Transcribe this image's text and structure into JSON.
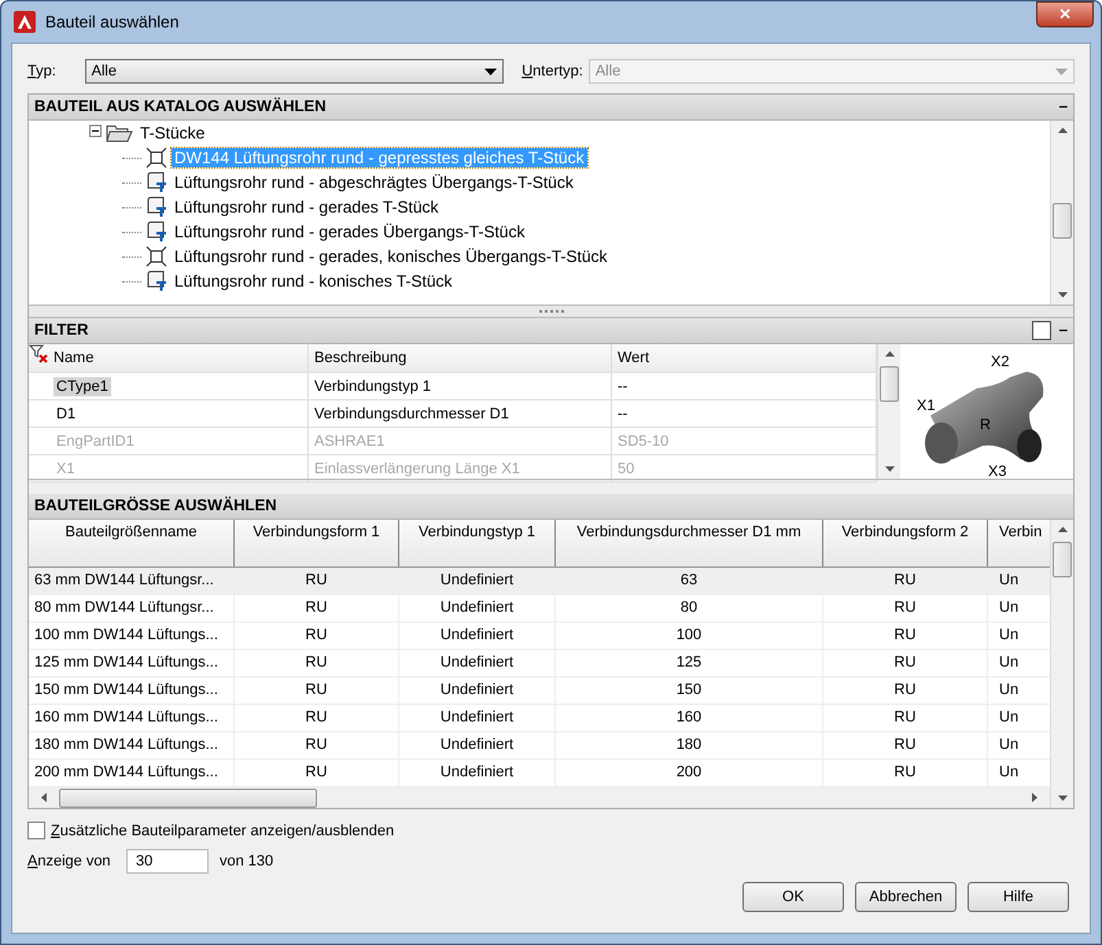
{
  "window": {
    "title": "Bauteil auswählen",
    "close": "✕"
  },
  "typ": {
    "label": "Typ:",
    "value": "Alle"
  },
  "untertyp": {
    "label": "Untertyp:",
    "value": "Alle",
    "disabled": true
  },
  "catalog": {
    "title": "BAUTEIL AUS KATALOG AUSWÄHLEN",
    "collapse": "–",
    "folder": {
      "label": "T-Stücke",
      "expanded": true,
      "children": [
        {
          "label": "DW144 Lüftungsrohr rund - gepresstes gleiches T-Stück",
          "kind": "corners",
          "selected": true
        },
        {
          "label": "Lüftungsrohr rund - abgeschrägtes Übergangs-T-Stück",
          "kind": "page",
          "selected": false
        },
        {
          "label": "Lüftungsrohr rund - gerades T-Stück",
          "kind": "page",
          "selected": false
        },
        {
          "label": "Lüftungsrohr rund - gerades Übergangs-T-Stück",
          "kind": "page",
          "selected": false
        },
        {
          "label": "Lüftungsrohr rund - gerades, konisches Übergangs-T-Stück",
          "kind": "corners",
          "selected": false
        },
        {
          "label": "Lüftungsrohr rund - konisches T-Stück",
          "kind": "page",
          "selected": false
        }
      ]
    }
  },
  "filter": {
    "title": "FILTER",
    "collapse": "–",
    "columns": [
      "Name",
      "Beschreibung",
      "Wert"
    ],
    "rows": [
      {
        "name": "CType1",
        "beschreibung": "Verbindungstyp 1",
        "wert": "--",
        "enabled": true,
        "selected": true
      },
      {
        "name": "D1",
        "beschreibung": "Verbindungsdurchmesser D1",
        "wert": "--",
        "enabled": true,
        "selected": false
      },
      {
        "name": "EngPartID1",
        "beschreibung": "ASHRAE1",
        "wert": "SD5-10",
        "enabled": false,
        "selected": false
      },
      {
        "name": "X1",
        "beschreibung": "Einlassverlängerung Länge X1",
        "wert": "50",
        "enabled": false,
        "selected": false
      }
    ],
    "preview": {
      "labels": [
        "X1",
        "X2",
        "R",
        "X3"
      ]
    }
  },
  "sizes": {
    "title": "BAUTEILGRÖSSE AUSWÄHLEN",
    "columns": [
      "Bauteilgrößenname",
      "Verbindungsform 1",
      "Verbindungstyp 1",
      "Verbindungsdurchmesser D1 mm",
      "Verbindungsform 2",
      "Verbin"
    ],
    "rows": [
      {
        "cells": [
          "63 mm DW144 Lüftungsr...",
          "RU",
          "Undefiniert",
          "63",
          "RU",
          "Un"
        ],
        "selected": true
      },
      {
        "cells": [
          "80 mm DW144 Lüftungsr...",
          "RU",
          "Undefiniert",
          "80",
          "RU",
          "Un"
        ],
        "selected": false
      },
      {
        "cells": [
          "100 mm DW144 Lüftungs...",
          "RU",
          "Undefiniert",
          "100",
          "RU",
          "Un"
        ],
        "selected": false
      },
      {
        "cells": [
          "125 mm DW144 Lüftungs...",
          "RU",
          "Undefiniert",
          "125",
          "RU",
          "Un"
        ],
        "selected": false
      },
      {
        "cells": [
          "150 mm DW144 Lüftungs...",
          "RU",
          "Undefiniert",
          "150",
          "RU",
          "Un"
        ],
        "selected": false
      },
      {
        "cells": [
          "160 mm DW144 Lüftungs...",
          "RU",
          "Undefiniert",
          "160",
          "RU",
          "Un"
        ],
        "selected": false
      },
      {
        "cells": [
          "180 mm DW144 Lüftungs...",
          "RU",
          "Undefiniert",
          "180",
          "RU",
          "Un"
        ],
        "selected": false
      },
      {
        "cells": [
          "200 mm DW144 Lüftungs...",
          "RU",
          "Undefiniert",
          "200",
          "RU",
          "Un"
        ],
        "selected": false
      }
    ]
  },
  "extra": {
    "label": "Zusätzliche Bauteilparameter anzeigen/ausblenden",
    "checked": false
  },
  "anzeige": {
    "label": "Anzeige von",
    "value": "30",
    "total": "von 130"
  },
  "buttons": [
    "OK",
    "Abbrechen",
    "Hilfe"
  ]
}
